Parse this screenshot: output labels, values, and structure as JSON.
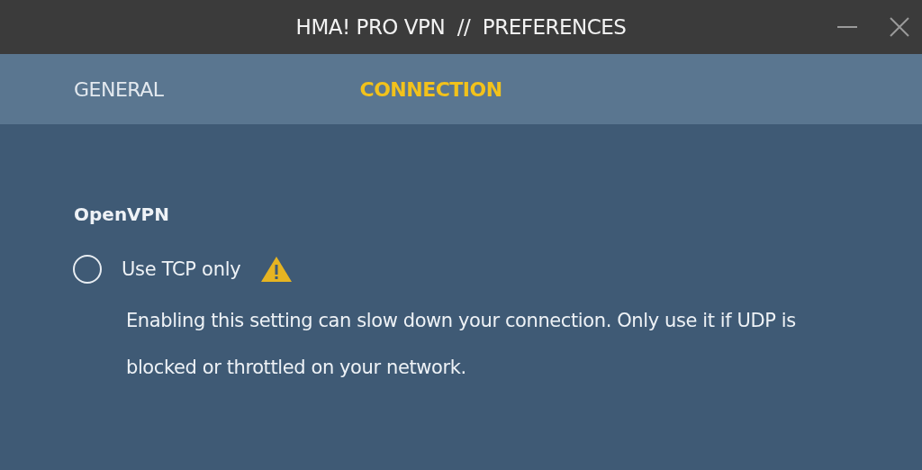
{
  "window": {
    "title": "HMA! PRO VPN  //  PREFERENCES"
  },
  "tabs": [
    {
      "label": "GENERAL",
      "selected": false
    },
    {
      "label": "CONNECTION",
      "selected": true
    }
  ],
  "section": {
    "heading": "OpenVPN"
  },
  "option": {
    "label": "Use TCP only",
    "checked": false,
    "description": "Enabling this setting can slow down your connection. Only use it if UDP is blocked or throttled on your network."
  }
}
